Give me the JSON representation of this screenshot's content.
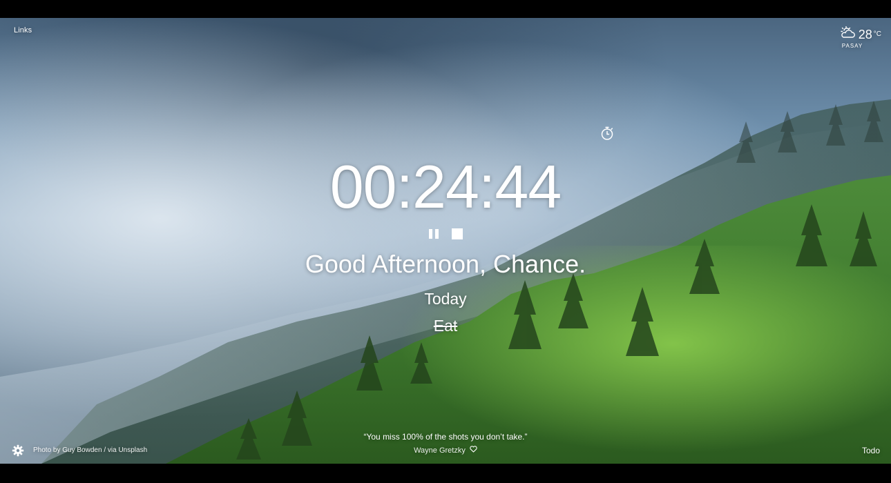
{
  "top_bar": {
    "links_label": "Links"
  },
  "weather": {
    "icon": "partly-cloudy-day-icon",
    "temperature": "28",
    "unit": "°C",
    "location": "PASAY"
  },
  "timer": {
    "icon": "stopwatch-icon",
    "time": "00:24:44",
    "pause_icon": "pause-icon",
    "stop_icon": "stop-icon"
  },
  "greeting": {
    "text": "Good Afternoon, Chance."
  },
  "focus": {
    "label": "Today",
    "task": "Eat",
    "completed": true
  },
  "quote": {
    "text": "“You miss 100% of the shots you don’t take.”",
    "author": "Wayne Gretzky",
    "favorite_icon": "heart-icon"
  },
  "footer": {
    "settings_icon": "gear-icon",
    "credit_prefix": "Photo by",
    "photographer": "Guy Bowden",
    "credit_via": "/ via",
    "source": "Unsplash",
    "todo_label": "Todo"
  },
  "colors": {
    "text": "#ffffff",
    "letterbox": "#000000"
  }
}
